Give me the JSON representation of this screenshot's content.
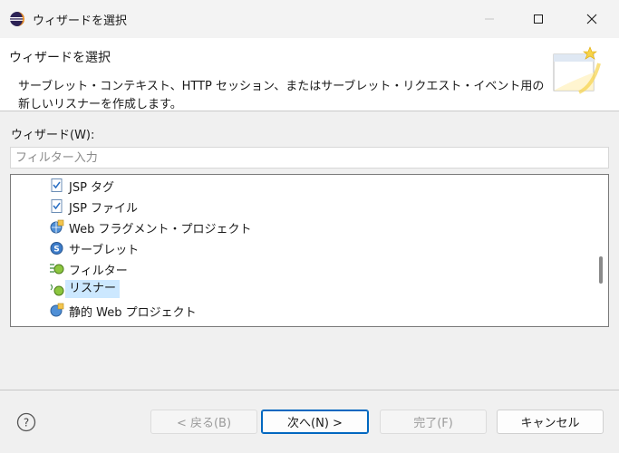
{
  "window": {
    "title": "ウィザードを選択",
    "app_icon": "eclipse-icon"
  },
  "banner": {
    "title": "ウィザードを選択",
    "description": "サーブレット・コンテキスト、HTTP セッション、またはサーブレット・リクエスト・イベント用の新しいリスナーを作成します。",
    "image": "new-wizard-icon"
  },
  "wizards": {
    "label": "ウィザード(W):",
    "filter_placeholder": "フィルター入力",
    "filter_value": "",
    "items": [
      {
        "label": "JSP タグ",
        "icon": "jsp-tag-icon"
      },
      {
        "label": "JSP ファイル",
        "icon": "jsp-file-icon"
      },
      {
        "label": "Web フラグメント・プロジェクト",
        "icon": "web-fragment-project-icon"
      },
      {
        "label": "サーブレット",
        "icon": "servlet-icon"
      },
      {
        "label": "フィルター",
        "icon": "filter-icon"
      },
      {
        "label": "リスナー",
        "icon": "listener-icon",
        "selected": true
      },
      {
        "label": "静的 Web プロジェクト",
        "icon": "static-web-project-icon"
      }
    ]
  },
  "buttons": {
    "help": "help-icon",
    "back": "< 戻る(B)",
    "next": "次へ(N) >",
    "finish": "完了(F)",
    "cancel": "キャンセル"
  },
  "colors": {
    "selection": "#cce8ff",
    "default_button_border": "#0067c0"
  }
}
